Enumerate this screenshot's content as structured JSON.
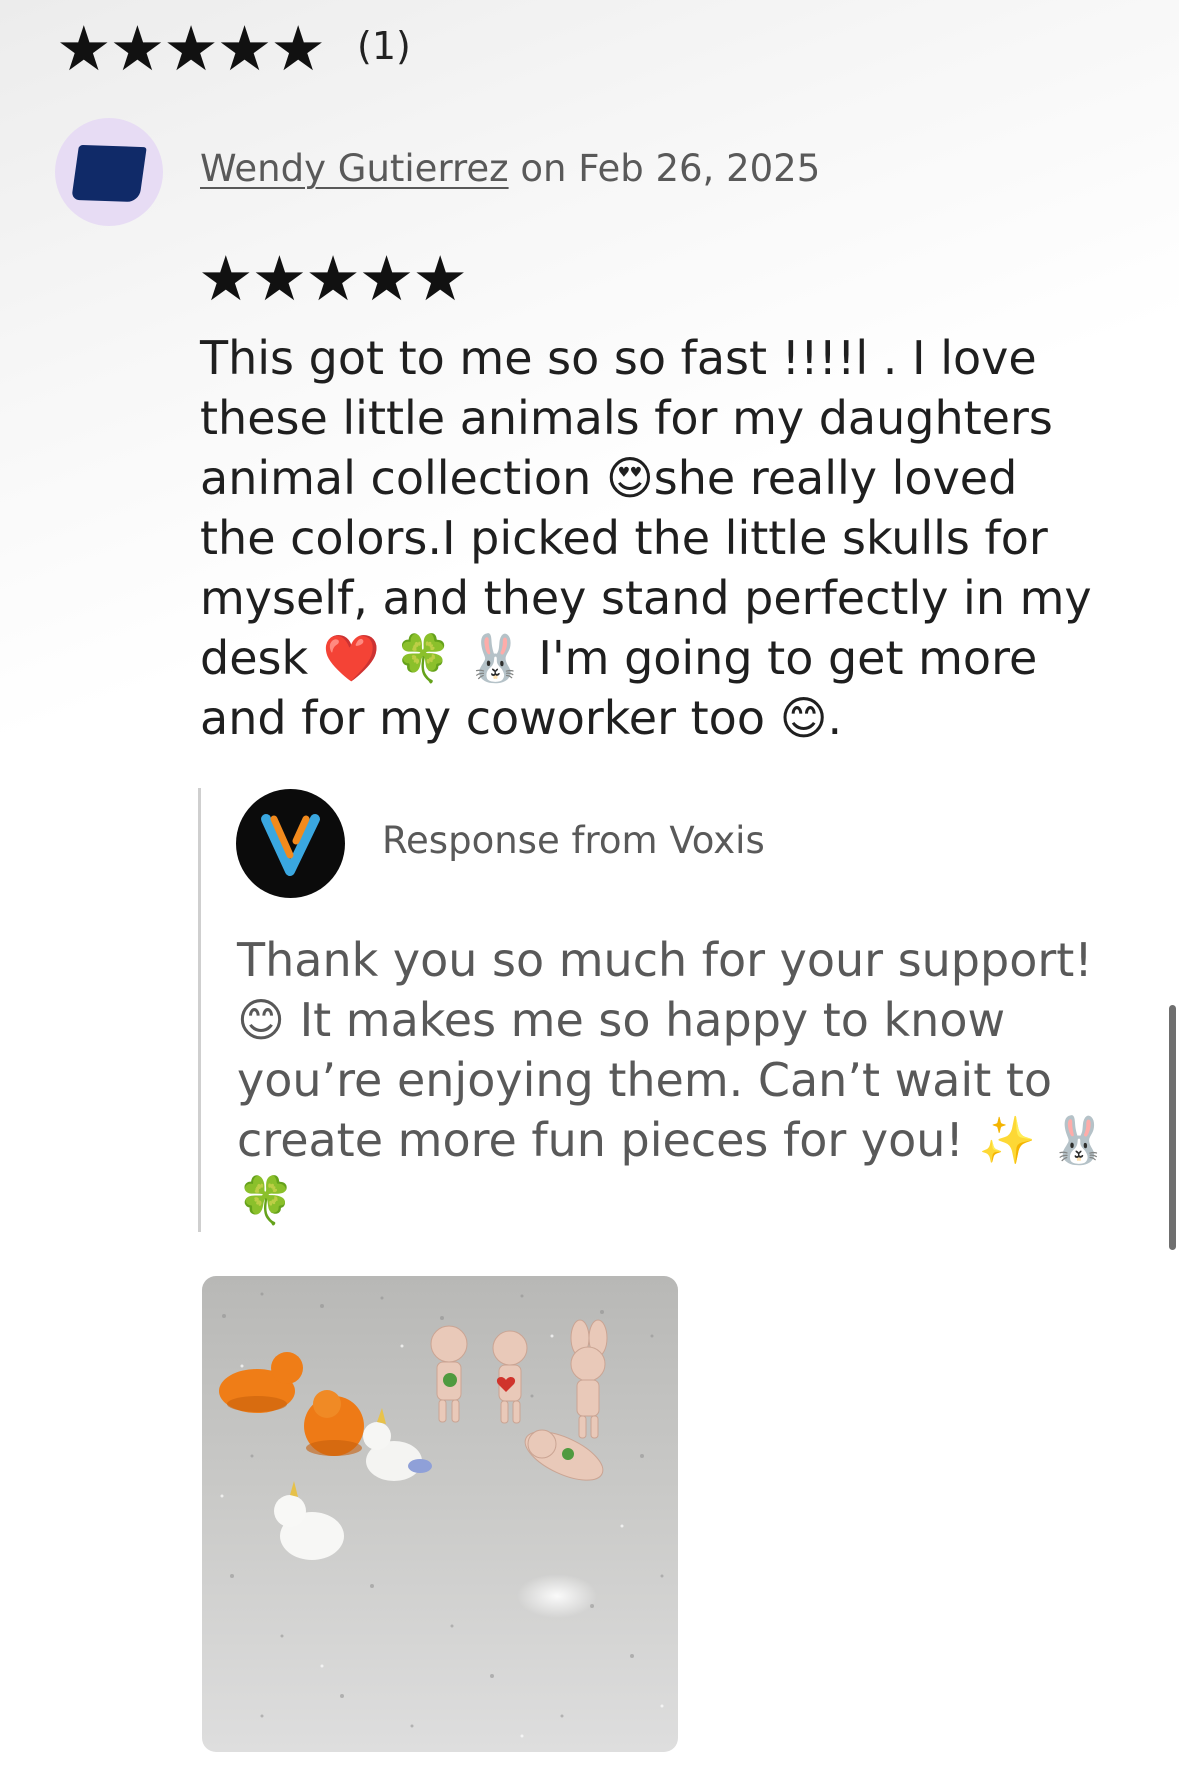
{
  "rating_summary": {
    "stars": [
      "★",
      "★",
      "★",
      "★",
      "★"
    ],
    "count": "(1)"
  },
  "review": {
    "reviewer_name": "Wendy Gutierrez",
    "date_text": "on Feb 26, 2025",
    "stars": [
      "★",
      "★",
      "★",
      "★",
      "★"
    ],
    "lines": [
      "This got to me so so fast !!!!l . I love",
      "these little animals for my daughters",
      "animal collection 😍she really loved",
      "the colors.I picked the little skulls for",
      "myself, and they stand perfectly in my",
      "desk ❤️  🍀  🐰  I'm going to get more",
      "and for my coworker too 😊."
    ],
    "photo_icon": "review-photo"
  },
  "response": {
    "title": "Response from Voxis",
    "logo_icon": "voxis-logo",
    "lines": [
      "Thank you so much for your support!",
      "😊  It makes me so happy to know",
      "you’re enjoying them. Can’t wait to",
      "create more fun pieces for you! ✨ 🐰",
      "🍀"
    ]
  },
  "colors": {
    "avatar_bg": "#e7dcf4",
    "avatar_shape": "#102a68",
    "logo_bg": "#0b0b0b",
    "logo_blue": "#3aa7e0",
    "logo_orange": "#f28a1d",
    "muted_text": "#595959"
  }
}
